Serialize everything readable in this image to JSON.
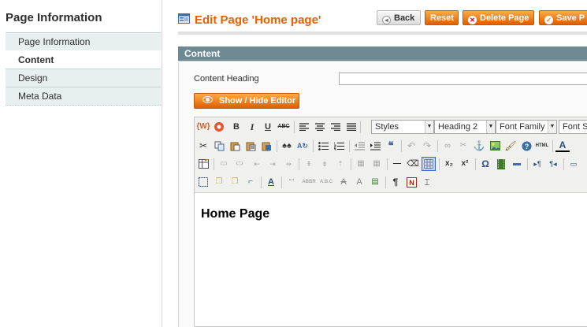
{
  "sidebar": {
    "title": "Page Information",
    "items": [
      {
        "label": "Page Information"
      },
      {
        "label": "Content"
      },
      {
        "label": "Design"
      },
      {
        "label": "Meta Data"
      }
    ]
  },
  "header": {
    "title": "Edit Page 'Home page'",
    "icon": "edit-page-icon",
    "buttons": {
      "back": "Back",
      "reset": "Reset",
      "delete": "Delete Page",
      "save": "Save P"
    }
  },
  "content": {
    "section_title": "Content",
    "heading_label": "Content Heading",
    "heading_value": "",
    "toggle_label": "Show / Hide Editor"
  },
  "editor": {
    "selects": {
      "styles": "Styles",
      "format": "Heading 2",
      "font_family": "Font Family",
      "font_size": "Font Siz"
    },
    "document_heading": "Home Page"
  },
  "colors": {
    "accent": "#eb5e00",
    "section_header": "#6f8992",
    "sidebar_item_bg": "#e7efef"
  }
}
